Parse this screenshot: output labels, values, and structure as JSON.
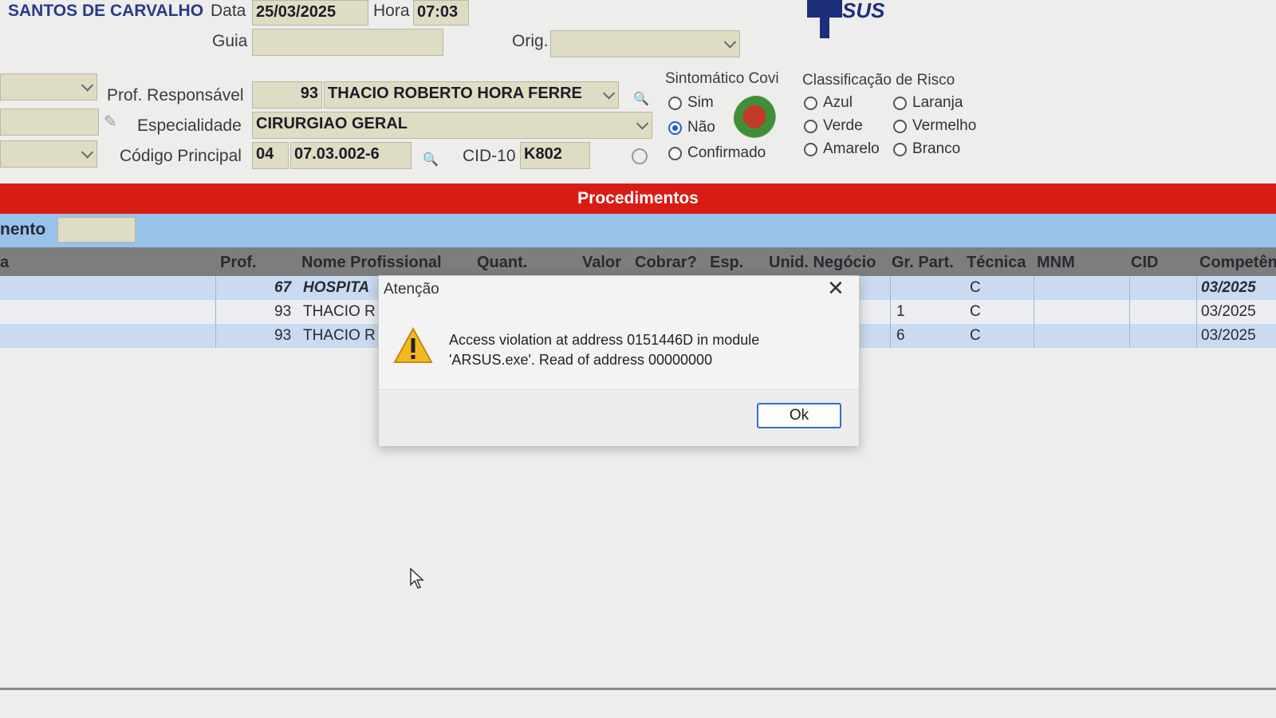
{
  "header": {
    "patient_name": "SANTOS DE CARVALHO",
    "date_label": "Data",
    "date_value": "25/03/2025",
    "time_label": "Hora",
    "time_value": "07:03",
    "guide_label": "Guia",
    "guide_value": "",
    "orig_label": "Orig.",
    "orig_value": "",
    "logo_text": "SUS"
  },
  "form": {
    "prof_label": "Prof. Responsável",
    "prof_code": "93",
    "prof_name": "THACIO ROBERTO HORA FERRE",
    "specialty_label": "Especialidade",
    "specialty_value": "CIRURGIAO GERAL",
    "main_code_label": "Código Principal",
    "main_code_prefix": "04",
    "main_code_value": "07.03.002-6",
    "cid_label": "CID-10",
    "cid_value": "K802"
  },
  "covid": {
    "title": "Sintomático Covi",
    "options": [
      "Sim",
      "Não",
      "Confirmado"
    ],
    "selected": "Não"
  },
  "risk": {
    "title": "Classificação de Risco",
    "options": [
      "Azul",
      "Laranja",
      "Verde",
      "Vermelho",
      "Amarelo",
      "Branco"
    ]
  },
  "procedures": {
    "title": "Procedimentos",
    "filter_label": "nento",
    "columns": [
      "a",
      "Prof.",
      "Nome Profissional",
      "Quant.",
      "Valor",
      "Cobrar?",
      "Esp.",
      "Unid. Negócio",
      "Gr. Part.",
      "Técnica",
      "MNM",
      "CID",
      "Competên"
    ],
    "rows": [
      {
        "prof": "67",
        "name": "HOSPITA",
        "gr_part": "",
        "tecnica": "C",
        "competencia": "03/2025"
      },
      {
        "prof": "93",
        "name": "THACIO R",
        "gr_part": "1",
        "tecnica": "C",
        "competencia": "03/2025"
      },
      {
        "prof": "93",
        "name": "THACIO R",
        "gr_part": "6",
        "tecnica": "C",
        "competencia": "03/2025"
      }
    ]
  },
  "dialog": {
    "title": "Atenção",
    "message_line1": "Access violation at address 0151446D in module",
    "message_line2": "'ARSUS.exe'. Read of address 00000000",
    "ok_label": "Ok"
  },
  "colors": {
    "red_bar": "#d81c14",
    "blue_bar": "#98c2ea",
    "field_bg": "#dfdcc4",
    "radio_selected": "#1d5fd1",
    "ok_border": "#2f6fd0"
  }
}
